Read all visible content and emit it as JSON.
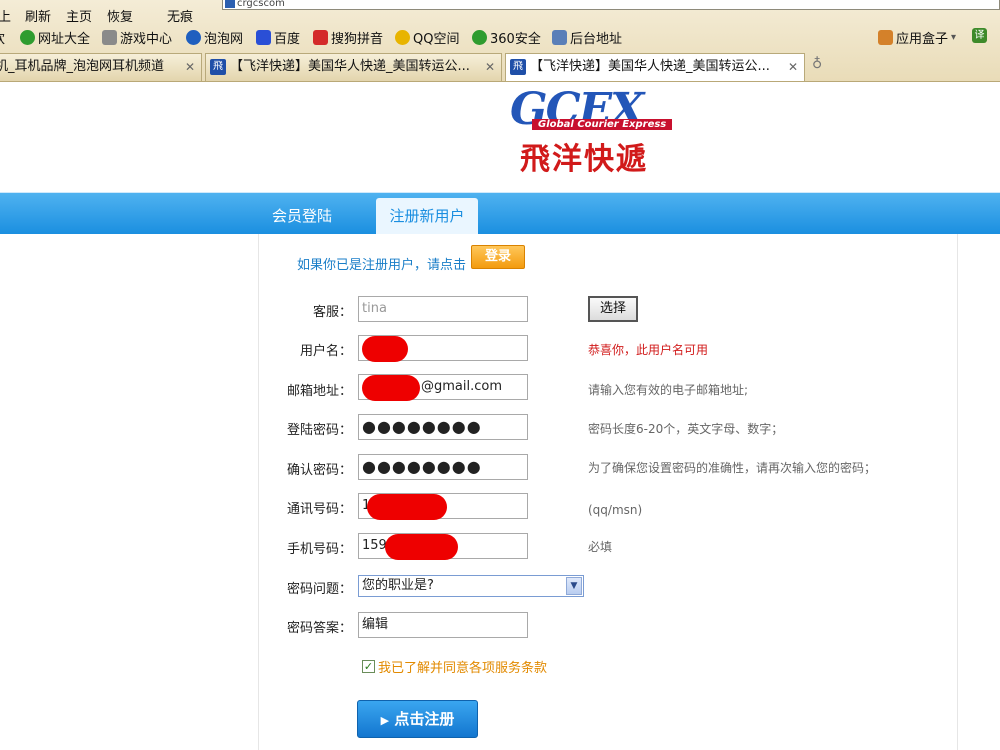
{
  "browser": {
    "menu": [
      "上",
      "刷新",
      "主页",
      "恢复",
      "无痕"
    ],
    "url_fragment": "crgcscom",
    "favorites": [
      {
        "label": "网址大全",
        "icon": "globe-icon",
        "color": "#2f9c2f"
      },
      {
        "label": "游戏中心",
        "icon": "gamepad-icon",
        "color": "#7a7a7a"
      },
      {
        "label": "泡泡网",
        "icon": "bubble-icon",
        "color": "#1f5fbf"
      },
      {
        "label": "百度",
        "icon": "paw-icon",
        "color": "#2a4fd6"
      },
      {
        "label": "搜狗拼音",
        "icon": "sogou-icon",
        "color": "#d42a2a"
      },
      {
        "label": "QQ空间",
        "icon": "star-icon",
        "color": "#e8b400"
      },
      {
        "label": "360安全",
        "icon": "shield-icon",
        "color": "#2f9c2f"
      },
      {
        "label": "后台地址",
        "icon": "page-icon",
        "color": "#5a7fb8"
      }
    ],
    "app_box": "应用盒子",
    "translate": "译 翻",
    "tabs": [
      {
        "label": "机_耳机品牌_泡泡网耳机频道",
        "active": false
      },
      {
        "label": "【飞洋快递】美国华人快递_美国转运公...",
        "active": false
      },
      {
        "label": "【飞洋快递】美国华人快递_美国转运公...",
        "active": true
      }
    ],
    "tab_close": "✕",
    "tab_icon_glyph": "飛"
  },
  "logo": {
    "brand": "GCEX",
    "tagline": "Global Courier Express",
    "cn_name": "飛洋快遞"
  },
  "nav": {
    "login_tab": "会员登陆",
    "register_tab": "注册新用户"
  },
  "form": {
    "prompt": "如果你已是注册用户，请点击",
    "login_button": "登录",
    "service_label": "客服：",
    "service_placeholder": "tina",
    "select_button": "选择",
    "username_label": "用户名：",
    "username_hint": "恭喜你，此用户名可用",
    "email_label": "邮箱地址：",
    "email_suffix": "@gmail.com",
    "email_hint": "请输入您有效的电子邮箱地址;",
    "password_label": "登陆密码：",
    "password_value": "●●●●●●●●",
    "password_hint": "密码长度6-20个，英文字母、数字；",
    "confirm_label": "确认密码：",
    "confirm_value": "●●●●●●●●",
    "confirm_hint": "为了确保您设置密码的准确性，请再次输入您的密码；",
    "phone_label": "通讯号码：",
    "phone_value": "1",
    "phone_hint": "(qq/msn)",
    "mobile_label": "手机号码：",
    "mobile_value": "159",
    "mobile_hint": "必填",
    "question_label": "密码问题：",
    "question_value": "您的职业是?",
    "answer_label": "密码答案：",
    "answer_value": "编辑",
    "agree_text": "我已了解并同意各项服务条款",
    "agree_checked": true,
    "submit_label": "点击注册"
  },
  "colors": {
    "nav_blue": "#1b8fe0",
    "hint_red": "#d11a1a",
    "agree_orange": "#e28a00",
    "login_orange": "#f39b0e"
  }
}
